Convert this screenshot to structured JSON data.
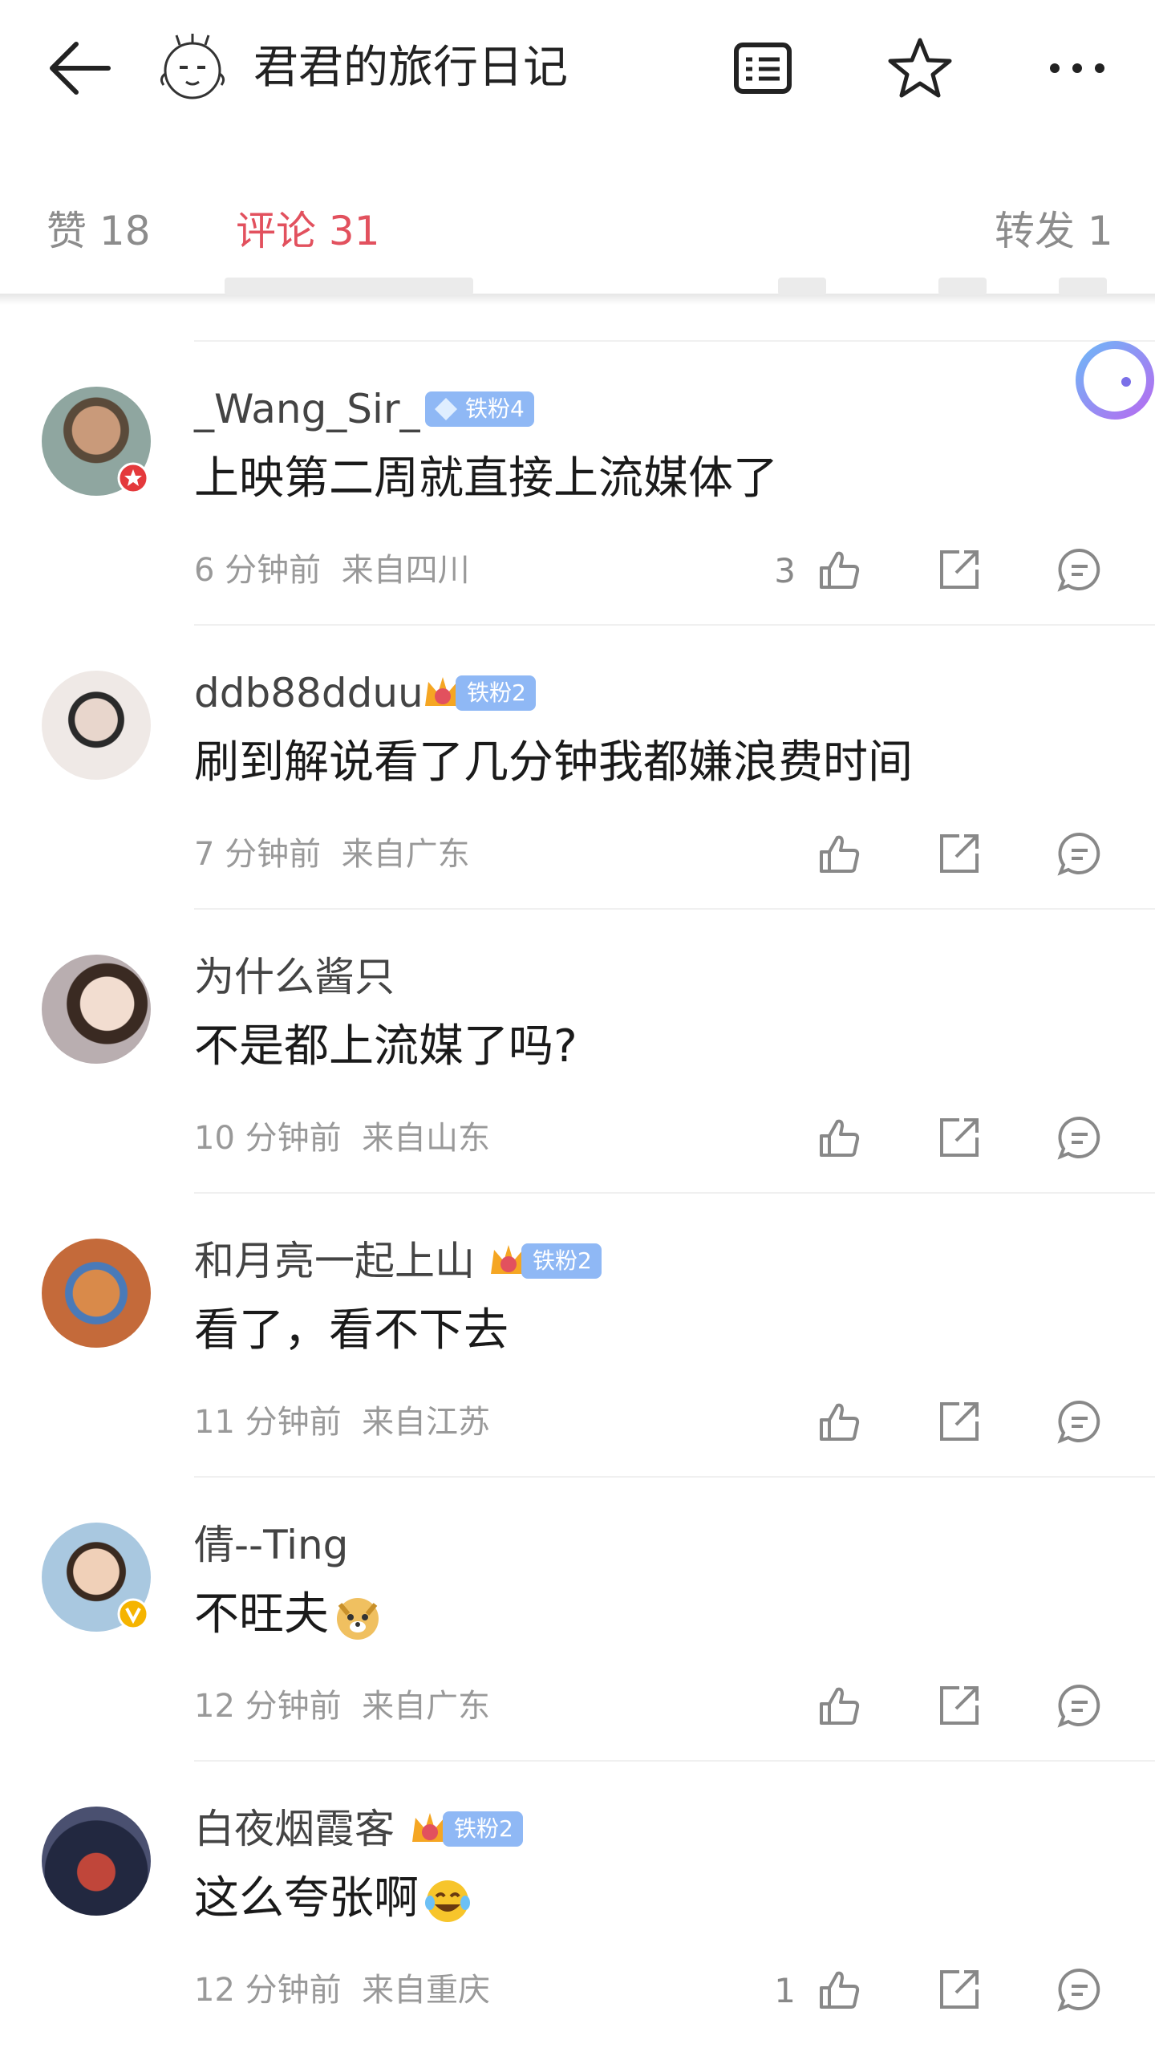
{
  "header": {
    "title": "君君的旅行日记",
    "icons": [
      "back-arrow-icon",
      "robot-avatar-icon",
      "notes-icon",
      "star-icon",
      "more-icon"
    ]
  },
  "tabs": {
    "likes": "赞 18",
    "comments": "评论 31",
    "reposts": "转发 1"
  },
  "colors": {
    "accent": "#e2515e",
    "badge": "#8fb8f5",
    "meta": "#999999"
  },
  "comments": [
    {
      "name": "_Wang_Sir_",
      "badge": "铁粉4",
      "crown_level": "",
      "text": "上映第二周就直接上流媒体了",
      "time": "6 分钟前",
      "location": "来自四川",
      "likes": "3"
    },
    {
      "name": "ddb88dduu",
      "badge": "铁粉2",
      "crown_level": "1",
      "text": "刷到解说看了几分钟我都嫌浪费时间",
      "time": "7 分钟前",
      "location": "来自广东",
      "likes": ""
    },
    {
      "name": "为什么酱只",
      "badge": "",
      "crown_level": "",
      "text": "不是都上流媒了吗?",
      "time": "10 分钟前",
      "location": "来自山东",
      "likes": ""
    },
    {
      "name": "和月亮一起上山",
      "badge": "铁粉2",
      "crown_level": "5",
      "text": "看了，看不下去",
      "time": "11 分钟前",
      "location": "来自江苏",
      "likes": ""
    },
    {
      "name": "倩--Ting",
      "badge": "",
      "crown_level": "",
      "text": "不旺夫",
      "emoji": "doge-emoji-icon",
      "time": "12 分钟前",
      "location": "来自广东",
      "likes": ""
    },
    {
      "name": "白夜烟霞客",
      "badge": "铁粉2",
      "crown_level": "6",
      "text": "这么夸张啊",
      "emoji": "laugh-cry-emoji-icon",
      "time": "12 分钟前",
      "location": "来自重庆",
      "likes": "1"
    }
  ]
}
